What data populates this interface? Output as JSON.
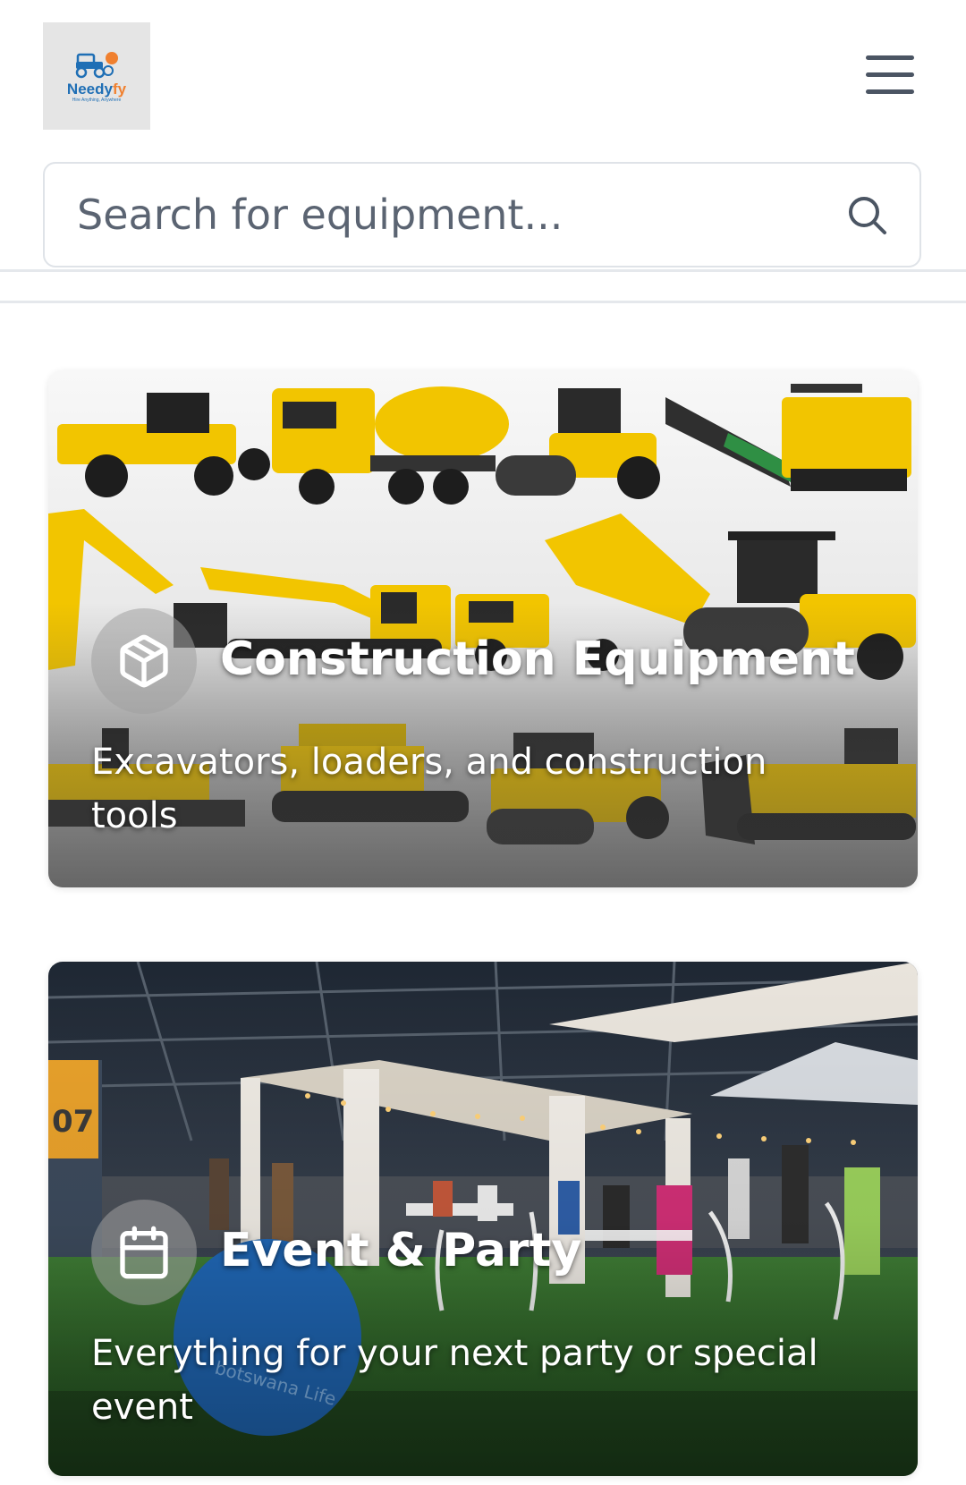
{
  "brand": {
    "name_main": "Needy",
    "name_accent": "fy",
    "tagline": "Hire Anything, Anywhere"
  },
  "header": {
    "menu_icon": "hamburger-menu-icon"
  },
  "search": {
    "placeholder": "Search for equipment...",
    "icon": "search-icon"
  },
  "categories": [
    {
      "title": "Construction Equipment",
      "description": "Excavators, loaders, and construction tools",
      "icon": "package-cube-icon"
    },
    {
      "title": "Event & Party",
      "description": "Everything for your next party or special event",
      "icon": "calendar-icon"
    }
  ],
  "colors": {
    "brand_blue": "#1f6fb5",
    "brand_orange": "#f0802f",
    "machinery_yellow": "#f2c500",
    "event_grass": "#2e6b2a"
  }
}
